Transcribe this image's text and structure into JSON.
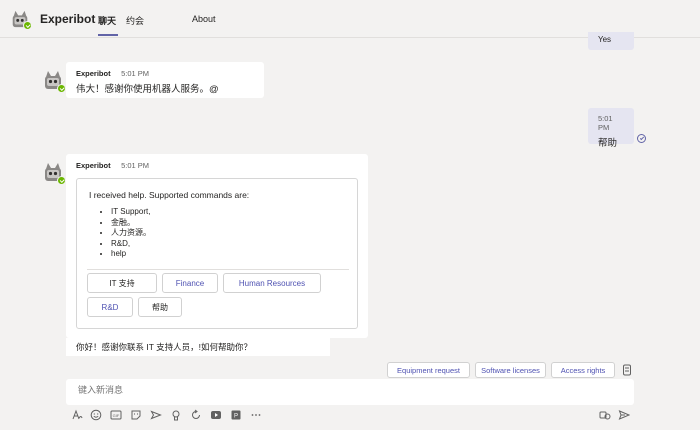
{
  "header": {
    "app_title": "Experibot",
    "tabs": [
      {
        "label": "聊天",
        "active": true
      },
      {
        "label": "约会",
        "active": false
      },
      {
        "label": "About",
        "active": false
      }
    ]
  },
  "messages": {
    "top_reply": "Yes",
    "bot1": {
      "sender": "Experibot",
      "time": "5:01 PM",
      "text": "伟大！感谢你使用机器人服务。@"
    },
    "me1": {
      "time": "5:01 PM",
      "text": "帮助"
    },
    "bot2": {
      "sender": "Experibot",
      "time": "5:01 PM"
    },
    "followup": "你好！感谢你联系 IT 支持人员，!如何帮助你？"
  },
  "card": {
    "intro": "I received help. Supported commands are:",
    "items": [
      "IT Support,",
      "金融。",
      "人力资源。",
      "R&D,",
      "help"
    ],
    "buttons": [
      "IT 支持",
      "Finance",
      "Human Resources",
      "R&D",
      "帮助"
    ]
  },
  "suggestions": [
    "Equipment request",
    "Software licenses",
    "Access rights"
  ],
  "compose": {
    "placeholder": "键入新消息"
  },
  "icons": {
    "format": "format-icon",
    "emoji": "emoji-icon",
    "gif": "gif-icon",
    "sticker": "sticker-icon",
    "send_later": "meet-icon",
    "praise": "praise-icon",
    "loop": "loop-icon",
    "video": "video-icon",
    "app": "app-icon",
    "more": "more-icon",
    "send": "send-icon"
  },
  "colors": {
    "accent": "#6264a7",
    "online": "#6bb700",
    "my_bubble": "#e5e5f1",
    "background": "#f3f2f1"
  }
}
